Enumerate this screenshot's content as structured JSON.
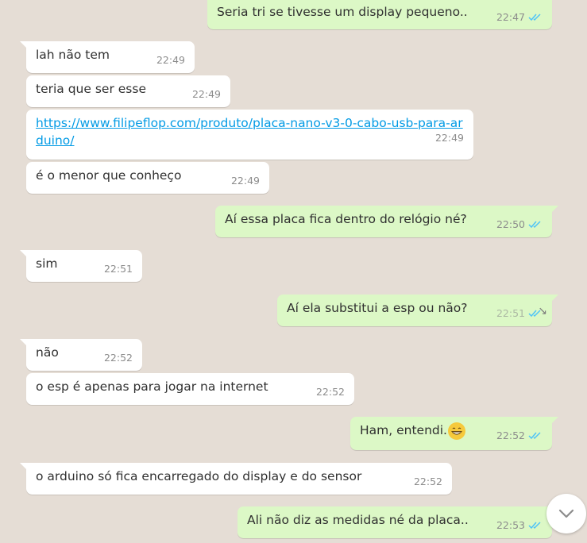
{
  "colors": {
    "background": "#e5ddd5",
    "incoming_bubble": "#ffffff",
    "outgoing_bubble": "#dcf8c6",
    "read_ticks": "#4fc3f7",
    "link": "#039be5"
  },
  "messages": [
    {
      "text": "Seria tri se tivesse um display pequeno..",
      "time": "22:47"
    },
    {
      "text": "lah não tem",
      "time": "22:49"
    },
    {
      "text": "teria que ser esse",
      "time": "22:49"
    },
    {
      "text": "https://www.filipeflop.com/produto/placa-nano-v3-0-cabo-usb-para-arduino/",
      "time": "22:49"
    },
    {
      "text": "é o menor que conheço",
      "time": "22:49"
    },
    {
      "text": "Aí essa placa fica dentro do relógio né?",
      "time": "22:50"
    },
    {
      "text": "sim",
      "time": "22:51"
    },
    {
      "text": "Aí ela substitui a esp ou não?",
      "time": "22:51"
    },
    {
      "text": "não",
      "time": "22:52"
    },
    {
      "text": "o esp é apenas para jogar na internet",
      "time": "22:52"
    },
    {
      "text": "Ham, entendi.",
      "time": "22:52"
    },
    {
      "text": "o arduino só fica encarregado do display e do sensor",
      "time": "22:52"
    },
    {
      "text": "Ali não diz as medidas né da placa..",
      "time": "22:53"
    }
  ],
  "scroll_button": {
    "icon": "chevron-down-icon"
  }
}
